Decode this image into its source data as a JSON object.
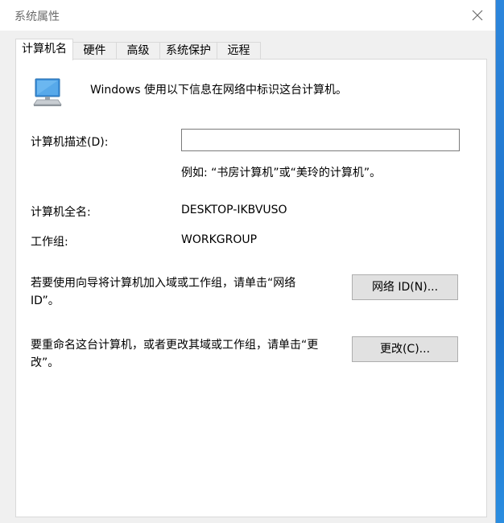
{
  "window": {
    "title": "系统属性"
  },
  "tabs": [
    {
      "label": "计算机名",
      "active": true
    },
    {
      "label": "硬件",
      "active": false
    },
    {
      "label": "高级",
      "active": false
    },
    {
      "label": "系统保护",
      "active": false
    },
    {
      "label": "远程",
      "active": false
    }
  ],
  "panel": {
    "intro_text": "Windows 使用以下信息在网络中标识这台计算机。",
    "description": {
      "label": "计算机描述(D):",
      "value": "",
      "example": "例如: “书房计算机”或“美玲的计算机”。"
    },
    "full_name": {
      "label": "计算机全名:",
      "value": "DESKTOP-IKBVUSO"
    },
    "workgroup": {
      "label": "工作组:",
      "value": "WORKGROUP"
    },
    "network_id": {
      "text": "若要使用向导将计算机加入域或工作组，请单击“网络ID”。",
      "button_label": "网络 ID(N)..."
    },
    "change": {
      "text": "要重命名这台计算机，或者更改其域或工作组，请单击“更改”。",
      "button_label": "更改(C)..."
    }
  },
  "colors": {
    "window_bg": "#f0f0f0",
    "panel_bg": "#ffffff",
    "button_bg": "#e1e1e1",
    "desktop": "#1f7fd6"
  },
  "icons": {
    "close": "close-icon",
    "computer": "computer-icon"
  }
}
